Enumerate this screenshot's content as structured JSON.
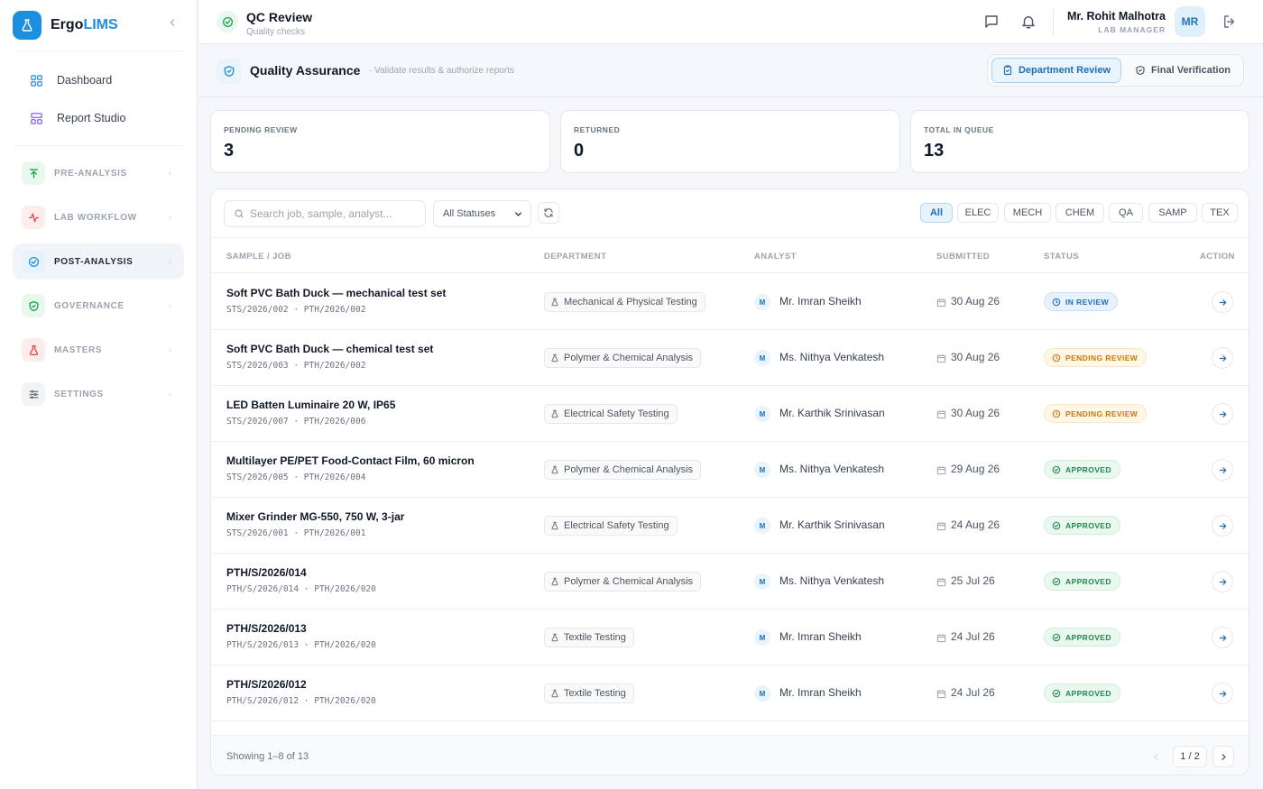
{
  "app": {
    "brand_a": "Ergo",
    "brand_b": "LIMS"
  },
  "sidebar": {
    "links": [
      {
        "label": "Dashboard",
        "icon": "grid-icon"
      },
      {
        "label": "Report Studio",
        "icon": "layout-icon"
      }
    ],
    "groups": [
      {
        "label": "PRE-ANALYSIS",
        "icon": "upload-arrow-icon",
        "color": "#16a34a",
        "bg": "#e9f8ef"
      },
      {
        "label": "LAB WORKFLOW",
        "icon": "activity-icon",
        "color": "#ef4444",
        "bg": "#fdecec"
      },
      {
        "label": "POST-ANALYSIS",
        "icon": "check-circle-icon",
        "color": "#1d8fe0",
        "bg": "#e6f2fc"
      },
      {
        "label": "GOVERNANCE",
        "icon": "shield-check-icon",
        "color": "#16a34a",
        "bg": "#e9f8ef"
      },
      {
        "label": "MASTERS",
        "icon": "flask-icon",
        "color": "#ef4444",
        "bg": "#fdecec"
      },
      {
        "label": "SETTINGS",
        "icon": "sliders-icon",
        "color": "#6b7280",
        "bg": "#f1f3f5"
      }
    ]
  },
  "topbar": {
    "title": "QC Review",
    "subtitle": "Quality checks",
    "user_name": "Mr. Rohit Malhotra",
    "user_role": "LAB MANAGER",
    "avatar_initials": "MR"
  },
  "page": {
    "title": "Quality Assurance",
    "subtitle": "· Validate results & authorize reports",
    "tabs": [
      "Department Review",
      "Final Verification"
    ]
  },
  "stats": [
    {
      "label": "PENDING REVIEW",
      "value": "3"
    },
    {
      "label": "RETURNED",
      "value": "0"
    },
    {
      "label": "TOTAL IN QUEUE",
      "value": "13"
    }
  ],
  "filters": {
    "search_placeholder": "Search job, sample, analyst...",
    "status_select": "All Statuses",
    "chips": [
      "All",
      "ELEC",
      "MECH",
      "CHEM",
      "QA",
      "SAMP",
      "TEX"
    ]
  },
  "table": {
    "columns": [
      "SAMPLE / JOB",
      "DEPARTMENT",
      "ANALYST",
      "SUBMITTED",
      "STATUS",
      "ACTION"
    ],
    "rows": [
      {
        "name": "Soft PVC Bath Duck — mechanical test set",
        "ids": "STS/2026/002  ·  PTH/2026/002",
        "dept": "Mechanical & Physical Testing",
        "initial": "M",
        "analyst": "Mr. Imran Sheikh",
        "date": "30 Aug 26",
        "status": "IN REVIEW",
        "kind": "review"
      },
      {
        "name": "Soft PVC Bath Duck — chemical test set",
        "ids": "STS/2026/003  ·  PTH/2026/002",
        "dept": "Polymer & Chemical Analysis",
        "initial": "M",
        "analyst": "Ms. Nithya Venkatesh",
        "date": "30 Aug 26",
        "status": "PENDING REVIEW",
        "kind": "pending"
      },
      {
        "name": "LED Batten Luminaire 20 W, IP65",
        "ids": "STS/2026/007  ·  PTH/2026/006",
        "dept": "Electrical Safety Testing",
        "initial": "M",
        "analyst": "Mr. Karthik Srinivasan",
        "date": "30 Aug 26",
        "status": "PENDING REVIEW",
        "kind": "pending"
      },
      {
        "name": "Multilayer PE/PET Food-Contact Film, 60 micron",
        "ids": "STS/2026/005  ·  PTH/2026/004",
        "dept": "Polymer & Chemical Analysis",
        "initial": "M",
        "analyst": "Ms. Nithya Venkatesh",
        "date": "29 Aug 26",
        "status": "APPROVED",
        "kind": "approved"
      },
      {
        "name": "Mixer Grinder MG-550, 750 W, 3-jar",
        "ids": "STS/2026/001  ·  PTH/2026/001",
        "dept": "Electrical Safety Testing",
        "initial": "M",
        "analyst": "Mr. Karthik Srinivasan",
        "date": "24 Aug 26",
        "status": "APPROVED",
        "kind": "approved"
      },
      {
        "name": "PTH/S/2026/014",
        "ids": "PTH/S/2026/014  ·  PTH/2026/020",
        "dept": "Polymer & Chemical Analysis",
        "initial": "M",
        "analyst": "Ms. Nithya Venkatesh",
        "date": "25 Jul 26",
        "status": "APPROVED",
        "kind": "approved"
      },
      {
        "name": "PTH/S/2026/013",
        "ids": "PTH/S/2026/013  ·  PTH/2026/020",
        "dept": "Textile Testing",
        "initial": "M",
        "analyst": "Mr. Imran Sheikh",
        "date": "24 Jul 26",
        "status": "APPROVED",
        "kind": "approved"
      },
      {
        "name": "PTH/S/2026/012",
        "ids": "PTH/S/2026/012  ·  PTH/2026/020",
        "dept": "Textile Testing",
        "initial": "M",
        "analyst": "Mr. Imran Sheikh",
        "date": "24 Jul 26",
        "status": "APPROVED",
        "kind": "approved"
      }
    ]
  },
  "footer": {
    "showing": "Showing 1–8 of 13",
    "page": "1 / 2"
  },
  "colors": {
    "accent": "#1d8fe0",
    "approved": "#1f8a4c",
    "pending": "#c77a06",
    "review": "#1d6fb8"
  }
}
